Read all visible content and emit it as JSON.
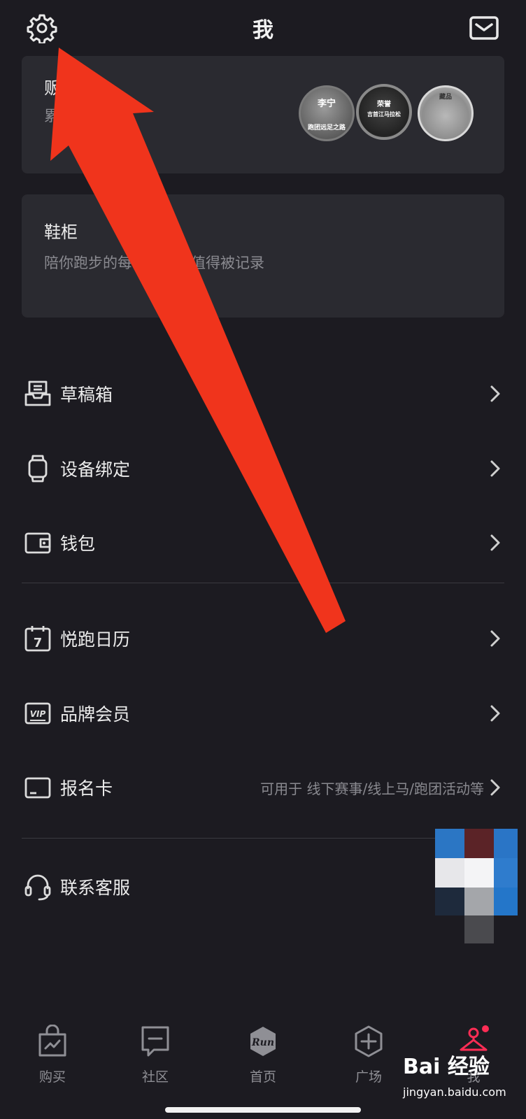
{
  "header": {
    "title": "我"
  },
  "assets_card": {
    "title": "贩",
    "subtitle": "累"
  },
  "medals": [
    {
      "label": "跑团远足之路",
      "top_text": "李宁"
    },
    {
      "label": "吉首江马拉松",
      "top_text": "荣誉"
    },
    {
      "label": "",
      "top_text": "藏品"
    }
  ],
  "shoe_card": {
    "title": "鞋柜",
    "subtitle": "陪你跑步的每一双鞋都值得被记录"
  },
  "menu": {
    "drafts": "草稿箱",
    "device": "设备绑定",
    "wallet": "钱包",
    "calendar": "悦跑日历",
    "calendar_day": "7",
    "vip": "品牌会员",
    "vip_badge": "VIP",
    "signup": "报名卡",
    "signup_hint": "可用于 线下赛事/线上马/跑团活动等",
    "service": "联系客服"
  },
  "tabs": [
    {
      "label": "购买"
    },
    {
      "label": "社区"
    },
    {
      "label": "首页",
      "logo": "Run"
    },
    {
      "label": "广场"
    },
    {
      "label": "我"
    }
  ],
  "watermark": {
    "brand": "Bai 经验",
    "url": "jingyan.baidu.com"
  },
  "colors": {
    "background": "#1c1b21",
    "card": "#2a2a30",
    "accent_red": "#f0341c",
    "badge_red": "#ff2d55"
  }
}
